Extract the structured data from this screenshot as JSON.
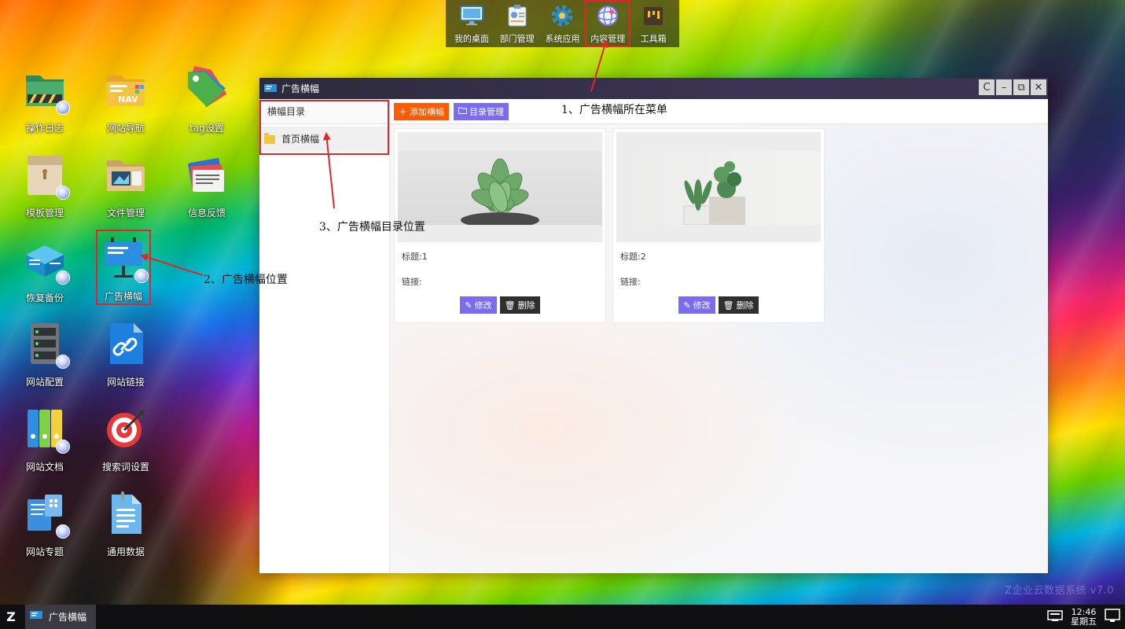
{
  "dock": {
    "items": [
      {
        "label": "我的桌面",
        "icon": "monitor-icon"
      },
      {
        "label": "部门管理",
        "icon": "id-card-icon"
      },
      {
        "label": "系统应用",
        "icon": "gear-icon"
      },
      {
        "label": "内容管理",
        "icon": "globe-icon"
      },
      {
        "label": "工具箱",
        "icon": "toolbox-icon"
      }
    ]
  },
  "desktop": {
    "icons": [
      {
        "label": "操作日志",
        "icon": "log-folder-icon"
      },
      {
        "label": "网站导航",
        "icon": "nav-folder-icon"
      },
      {
        "label": "tag设置",
        "icon": "tag-icon"
      },
      {
        "label": "模板管理",
        "icon": "template-icon"
      },
      {
        "label": "文件管理",
        "icon": "file-folder-icon"
      },
      {
        "label": "信息反馈",
        "icon": "feedback-icon"
      },
      {
        "label": "恢复备份",
        "icon": "backup-icon"
      },
      {
        "label": "广告横幅",
        "icon": "banner-icon"
      },
      {
        "label": "网站配置",
        "icon": "server-icon"
      },
      {
        "label": "网站链接",
        "icon": "link-icon"
      },
      {
        "label": "网站文档",
        "icon": "binders-icon"
      },
      {
        "label": "搜索词设置",
        "icon": "target-icon"
      },
      {
        "label": "网站专题",
        "icon": "topic-icon"
      },
      {
        "label": "通用数据",
        "icon": "document-icon"
      }
    ]
  },
  "window": {
    "title": "广告横幅",
    "controls": {
      "refresh": "C",
      "minimize": "–",
      "restore": "⧉",
      "close": "✕"
    },
    "sidebar": {
      "header": "横幅目录",
      "items": [
        {
          "label": "首页横幅"
        }
      ]
    },
    "toolbar": {
      "add_label": "添加横幅",
      "catalog_label": "目录管理"
    },
    "cards": [
      {
        "title_label": "标题:1",
        "link_label": "链接:",
        "edit_label": "修改",
        "delete_label": "删除"
      },
      {
        "title_label": "标题:2",
        "link_label": "链接:",
        "edit_label": "修改",
        "delete_label": "删除"
      }
    ]
  },
  "annotations": {
    "a1": "1、广告横幅所在菜单",
    "a2": "2、广告横幅位置",
    "a3": "3、广告横幅目录位置"
  },
  "watermark": "Z企业云数据系统  v7.0",
  "taskbar": {
    "start_glyph": "Z",
    "task_label": "广告横幅",
    "clock_time": "12:46",
    "clock_day": "星期五"
  },
  "colors": {
    "accent_orange": "#ff5a00",
    "accent_purple": "#7a6cf0",
    "annotation_red": "#e0262a",
    "titlebar": "#2d2a3c"
  }
}
